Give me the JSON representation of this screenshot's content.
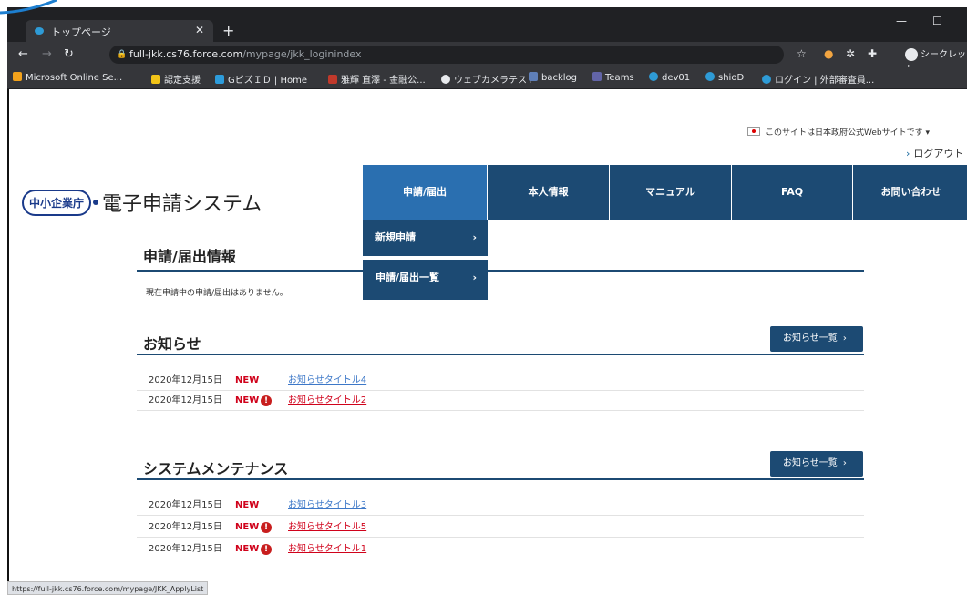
{
  "browser": {
    "tab_title": "トップページ",
    "url_host": "full-jkk.cs76.force.com",
    "url_path": "/mypage/jkk_loginindex",
    "profile_label": "シークレット",
    "bookmarks": [
      {
        "label": "Microsoft Online Se...",
        "color": "#f3a21b"
      },
      {
        "label": "認定支援",
        "color": "#f2c418"
      },
      {
        "label": "GビズＩＤ | Home",
        "color": "#2d9cdb"
      },
      {
        "label": "雅輝 直澤 - 金融公...",
        "color": "#c0392b"
      },
      {
        "label": "ウェブカメラテスト",
        "color": "#e8eaed"
      },
      {
        "label": "backlog",
        "color": "#5f7fb8"
      },
      {
        "label": "Teams",
        "color": "#6264a7"
      },
      {
        "label": "dev01",
        "color": "#2e9bd6"
      },
      {
        "label": "shioD",
        "color": "#2e9bd6"
      },
      {
        "label": "ログイン | 外部審査員...",
        "color": "#2e9bd6"
      }
    ],
    "status_url": "https://full-jkk.cs76.force.com/mypage/JKK_ApplyList"
  },
  "header": {
    "gov_note": "このサイトは日本政府公式Webサイトです",
    "logout": "ログアウト",
    "logo_badge": "中小企業庁",
    "system_name": "電子申請システム"
  },
  "nav": {
    "items": [
      "申請/届出",
      "本人情報",
      "マニュアル",
      "FAQ",
      "お問い合わせ"
    ],
    "dropdown": [
      "新規申請",
      "申請/届出一覧"
    ]
  },
  "applications": {
    "title": "申請/届出情報",
    "empty_message": "現在申請中の申請/届出はありません。"
  },
  "notices": {
    "title": "お知らせ",
    "more_button": "お知らせ一覧",
    "rows": [
      {
        "date": "2020年12月15日",
        "badge": "NEW",
        "important": false,
        "title": "お知らせタイトル4"
      },
      {
        "date": "2020年12月15日",
        "badge": "NEW",
        "important": true,
        "title": "お知らせタイトル2"
      }
    ]
  },
  "maintenance": {
    "title": "システムメンテナンス",
    "more_button": "お知らせ一覧",
    "rows": [
      {
        "date": "2020年12月15日",
        "badge": "NEW",
        "important": false,
        "title": "お知らせタイトル3"
      },
      {
        "date": "2020年12月15日",
        "badge": "NEW",
        "important": true,
        "title": "お知らせタイトル5"
      },
      {
        "date": "2020年12月15日",
        "badge": "NEW",
        "important": true,
        "title": "お知らせタイトル1"
      }
    ]
  },
  "colors": {
    "nav_bg": "#1c4a73",
    "nav_active": "#2a6fb0",
    "new_badge": "#d0021b",
    "link": "#3d78c8"
  }
}
